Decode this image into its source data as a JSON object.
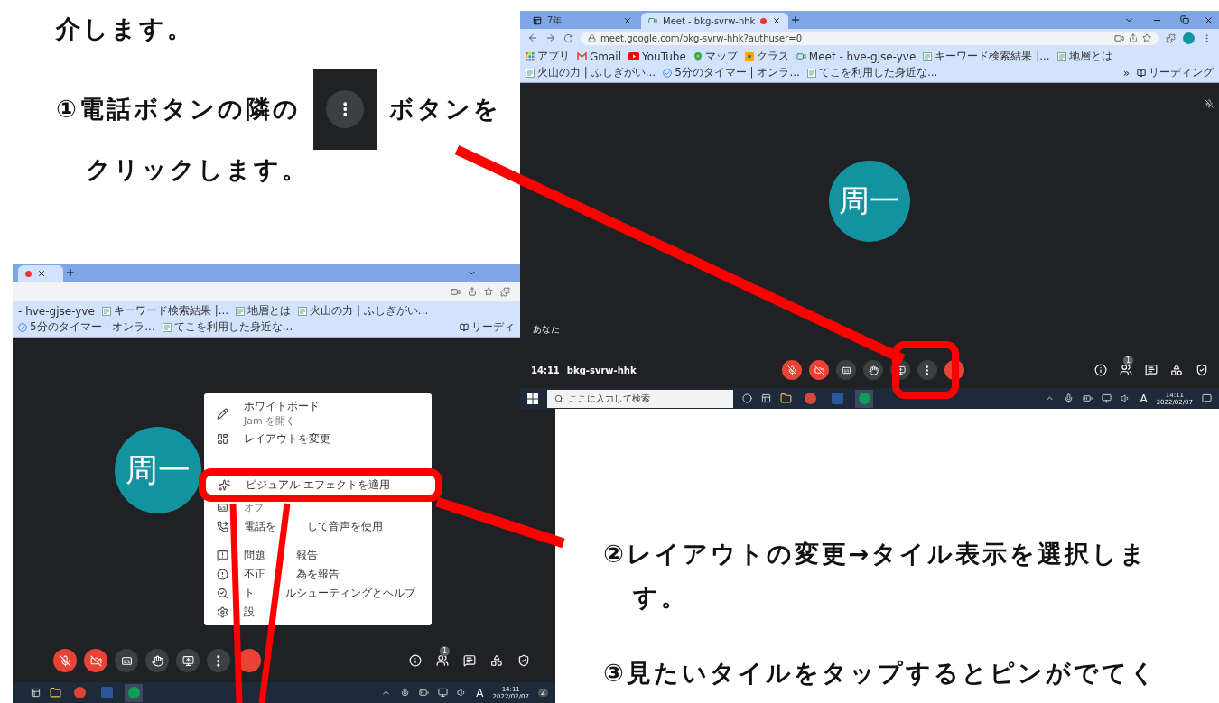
{
  "document": {
    "intro_tail": "介します。",
    "step1": {
      "before": "①電話ボタンの隣の",
      "after": "ボタンを",
      "line2": "クリックします。"
    },
    "step2": {
      "line1": "②レイアウトの変更→タイル表示を選択しま",
      "line2": "す。"
    },
    "step3": "③見たいタイルをタップするとピンがでてく"
  },
  "screenshot_top": {
    "tabs": [
      {
        "title": "7年",
        "selected": false,
        "recording": false
      },
      {
        "title": "Meet - bkg-svrw-hhk",
        "selected": true,
        "recording": true
      }
    ],
    "url": "meet.google.com/bkg-svrw-hhk?authuser=0",
    "bookmarks": [
      {
        "kind": "apps",
        "label": "アプリ"
      },
      {
        "kind": "gmail",
        "label": "Gmail"
      },
      {
        "kind": "youtube",
        "label": "YouTube"
      },
      {
        "kind": "maps",
        "label": "マップ"
      },
      {
        "kind": "classroom",
        "label": "クラス"
      },
      {
        "kind": "meet",
        "label": "Meet - hve-gjse-yve"
      },
      {
        "kind": "page",
        "label": "キーワード検索結果 |..."
      },
      {
        "kind": "page",
        "label": "地層とは"
      },
      {
        "kind": "page",
        "label": "火山の力 | ふしぎがい..."
      },
      {
        "kind": "timer",
        "label": "5分のタイマー | オンラ..."
      },
      {
        "kind": "page",
        "label": "てこを利用した身近な..."
      }
    ],
    "more_bookmarks": "»",
    "reading_list": "リーディング",
    "avatar": "周一",
    "self_label": "あなた",
    "time": "14:11",
    "meeting_code": "bkg-svrw-hhk",
    "participants_badge": "1",
    "controls": [
      {
        "kind": "mic-off"
      },
      {
        "kind": "camera-off"
      },
      {
        "kind": "captions"
      },
      {
        "kind": "hand"
      },
      {
        "kind": "present"
      },
      {
        "kind": "more"
      },
      {
        "kind": "hangup"
      }
    ],
    "search_placeholder": "ここに入力して検索",
    "ime": "A",
    "clock_time": "14:11",
    "clock_date": "2022/02/07"
  },
  "screenshot_bottom": {
    "bookmarks": [
      {
        "kind": "none",
        "label": "- hve-gjse-yve"
      },
      {
        "kind": "page",
        "label": "キーワード検索結果 |..."
      },
      {
        "kind": "page",
        "label": "地層とは"
      },
      {
        "kind": "page",
        "label": "火山の力 | ふしぎがい..."
      },
      {
        "kind": "timer",
        "label": "5分のタイマー | オンラ..."
      },
      {
        "kind": "page",
        "label": "てこを利用した身近な..."
      }
    ],
    "reading_list": "リーディ",
    "avatar": "周一",
    "menu": [
      {
        "kind": "pen",
        "label": [
          "ホワイトボード"
        ],
        "sublabel": "Jam を開く",
        "highlighted": false,
        "divider_after": false
      },
      {
        "kind": "layout",
        "label": [
          "レイアウトを変更"
        ],
        "highlighted": false,
        "divider_after": false
      },
      {
        "kind": "sparkles",
        "label": [
          "ビジュアル エフェクトを適用"
        ],
        "highlighted": true,
        "divider_after": false
      },
      {
        "kind": "captions",
        "sublabel": "オフ",
        "highlighted": false,
        "divider_after": false
      },
      {
        "kind": "phone-forward",
        "label": [
          "電話を",
          "して音声を使用"
        ],
        "highlighted": false,
        "divider_after": true
      },
      {
        "kind": "report",
        "label": [
          "問題",
          "報告"
        ],
        "highlighted": false,
        "divider_after": false
      },
      {
        "kind": "alert",
        "label": [
          "不正",
          "為を報告"
        ],
        "highlighted": false,
        "divider_after": false
      },
      {
        "kind": "troubleshoot",
        "label": [
          "ト",
          "ルシューティングとヘルプ"
        ],
        "highlighted": false,
        "divider_after": false
      },
      {
        "kind": "settings",
        "label": [
          "設"
        ],
        "highlighted": false,
        "divider_after": false
      }
    ],
    "controls": [
      {
        "kind": "mic-off"
      },
      {
        "kind": "camera-off"
      },
      {
        "kind": "captions"
      },
      {
        "kind": "hand"
      },
      {
        "kind": "present"
      },
      {
        "kind": "more"
      },
      {
        "kind": "hangup"
      }
    ],
    "participants_badge": "1",
    "ime": "A",
    "clock_time": "14:11",
    "clock_date": "2022/02/07",
    "notifications": "2"
  }
}
